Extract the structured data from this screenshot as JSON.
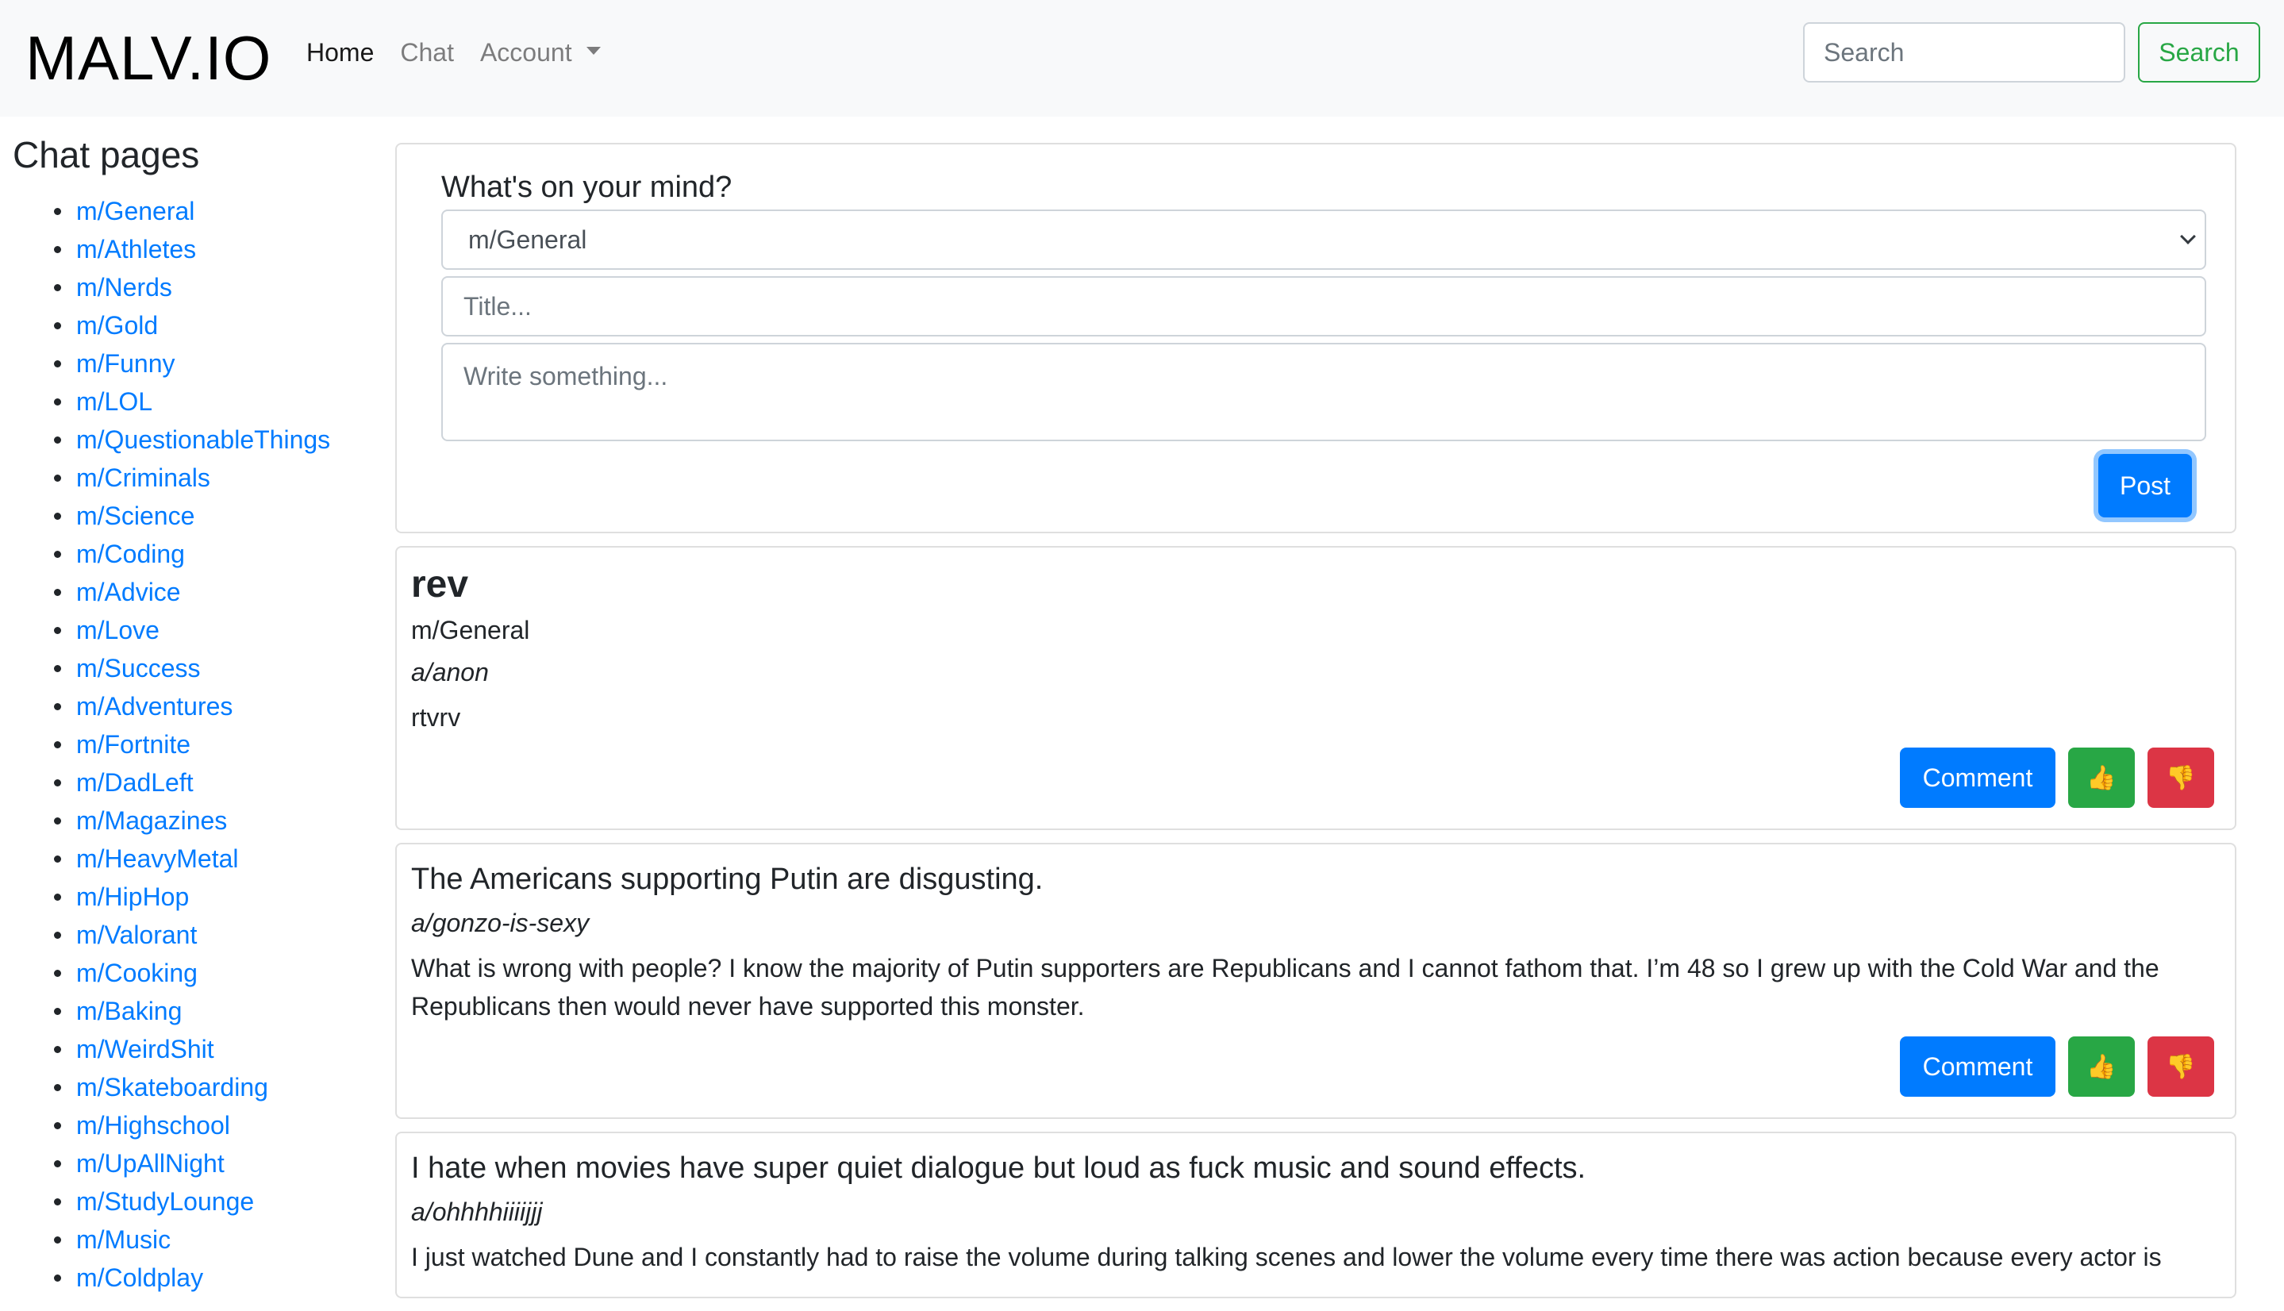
{
  "navbar": {
    "brand": "MALV.IO",
    "links": [
      {
        "label": "Home",
        "active": true
      },
      {
        "label": "Chat",
        "active": false
      },
      {
        "label": "Account",
        "active": false
      }
    ],
    "search_placeholder": "Search",
    "search_button": "Search"
  },
  "sidebar": {
    "heading": "Chat pages",
    "items": [
      "m/General",
      "m/Athletes",
      "m/Nerds",
      "m/Gold",
      "m/Funny",
      "m/LOL",
      "m/QuestionableThings",
      "m/Criminals",
      "m/Science",
      "m/Coding",
      "m/Advice",
      "m/Love",
      "m/Success",
      "m/Adventures",
      "m/Fortnite",
      "m/DadLeft",
      "m/Magazines",
      "m/HeavyMetal",
      "m/HipHop",
      "m/Valorant",
      "m/Cooking",
      "m/Baking",
      "m/WeirdShit",
      "m/Skateboarding",
      "m/Highschool",
      "m/UpAllNight",
      "m/StudyLounge",
      "m/Music",
      "m/Coldplay"
    ]
  },
  "composer": {
    "heading": "What's on your mind?",
    "selected_page": "m/General",
    "title_placeholder": "Title...",
    "body_placeholder": "Write something...",
    "post_button": "Post"
  },
  "posts": [
    {
      "title": "rev",
      "page": "m/General",
      "author": "a/anon",
      "body": "rtvrv",
      "comment_button": "Comment",
      "upvote": "👍",
      "downvote": "👎"
    },
    {
      "title": "The Americans supporting Putin are disgusting.",
      "author": "a/gonzo-is-sexy",
      "body": "What is wrong with people? I know the majority of Putin supporters are Republicans and I cannot fathom that. I’m 48 so I grew up with the Cold War and the Republicans then would never have supported this monster.",
      "comment_button": "Comment",
      "upvote": "👍",
      "downvote": "👎"
    },
    {
      "title": "I hate when movies have super quiet dialogue but loud as fuck music and sound effects.",
      "author": "a/ohhhhiiiijjj",
      "body": "I just watched Dune and I constantly had to raise the volume during talking scenes and lower the volume every time there was action because every actor is"
    }
  ],
  "colors": {
    "primary": "#007bff",
    "success": "#28a745",
    "danger": "#dc3545",
    "navbar_bg": "#f8f9fa"
  }
}
